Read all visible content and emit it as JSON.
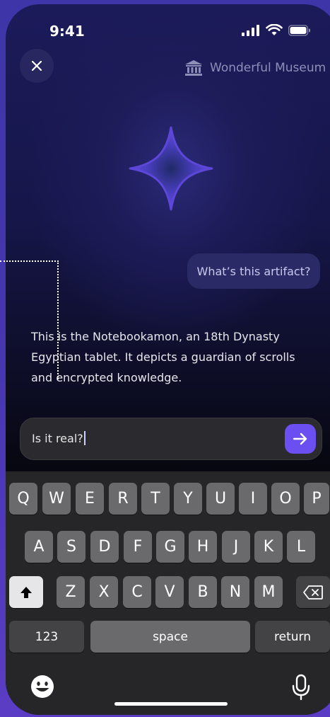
{
  "status": {
    "time": "9:41"
  },
  "header": {
    "museum_name": "Wonderful Museum",
    "close_icon": "close-icon",
    "museum_icon": "museum-building-icon"
  },
  "chat": {
    "user_message": "What’s this artifact?",
    "assistant_reply": "This is the Notebookamon, an 18th Dynasty Egyptian tablet. It depicts a guardian of scrolls and encrypted knowledge."
  },
  "input": {
    "value": "Is it real?",
    "send_icon": "arrow-right-icon"
  },
  "keyboard": {
    "row1": [
      "Q",
      "W",
      "E",
      "R",
      "T",
      "Y",
      "U",
      "I",
      "O",
      "P"
    ],
    "row2": [
      "A",
      "S",
      "D",
      "F",
      "G",
      "H",
      "J",
      "K",
      "L"
    ],
    "row3": [
      "Z",
      "X",
      "C",
      "V",
      "B",
      "N",
      "M"
    ],
    "numbers_label": "123",
    "space_label": "space",
    "return_label": "return"
  },
  "colors": {
    "accent": "#6c4ff0",
    "bubble": "#2a2a66"
  }
}
